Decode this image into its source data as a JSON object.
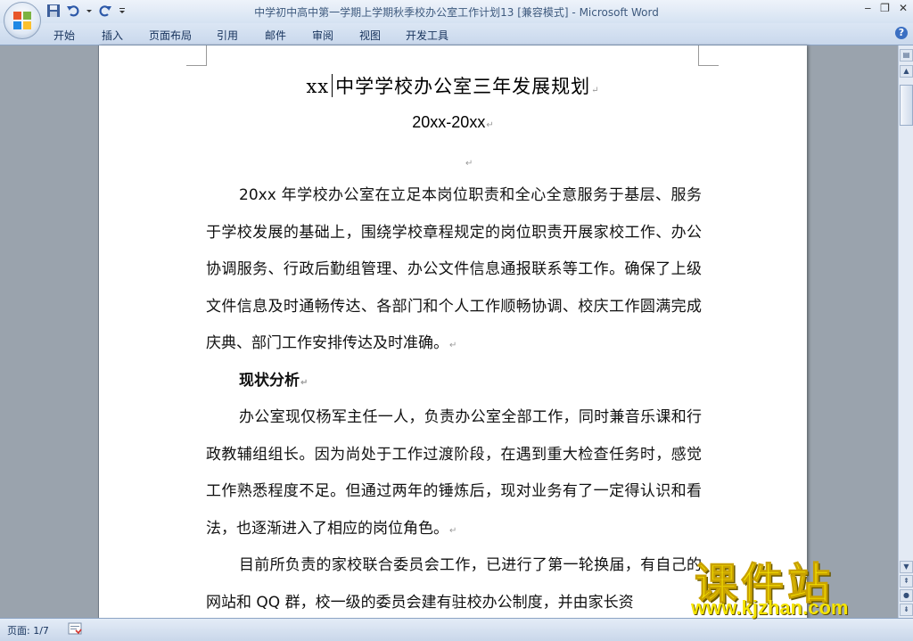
{
  "window": {
    "title": "中学初中高中第一学期上学期秋季校办公室工作计划13 [兼容模式] - ",
    "app_name": "Microsoft Word"
  },
  "ribbon": {
    "tabs": [
      "开始",
      "插入",
      "页面布局",
      "引用",
      "邮件",
      "审阅",
      "视图",
      "开发工具"
    ]
  },
  "document": {
    "title_prefix": "xx",
    "title_main": "中学学校办公室三年发展规划",
    "subtitle": "20xx-20xx",
    "paragraph_mark": "↵",
    "para1": "20xx 年学校办公室在立足本岗位职责和全心全意服务于基层、服务于学校发展的基础上，围绕学校章程规定的岗位职责开展家校工作、办公协调服务、行政后勤组管理、办公文件信息通报联系等工作。确保了上级文件信息及时通畅传达、各部门和个人工作顺畅协调、校庆工作圆满完成庆典、部门工作安排传达及时准确。",
    "heading1": "现状分析",
    "para2": "办公室现仅杨军主任一人，负责办公室全部工作，同时兼音乐课和行政教辅组组长。因为尚处于工作过渡阶段，在遇到重大检查任务时，感觉工作熟悉程度不足。但通过两年的锤炼后，现对业务有了一定得认识和看法，也逐渐进入了相应的岗位角色。",
    "para3": "目前所负责的家校联合委员会工作，已进行了第一轮换届，有自己的网站和 QQ 群，校一级的委员会建有驻校办公制度，并由家长资"
  },
  "statusbar": {
    "page": "页面: 1/7"
  },
  "watermark": {
    "name": "课件站",
    "url": "www.kjzhan.com"
  },
  "colors": {
    "ribbon_text": "#15315b",
    "watermark": "#f5e400"
  }
}
